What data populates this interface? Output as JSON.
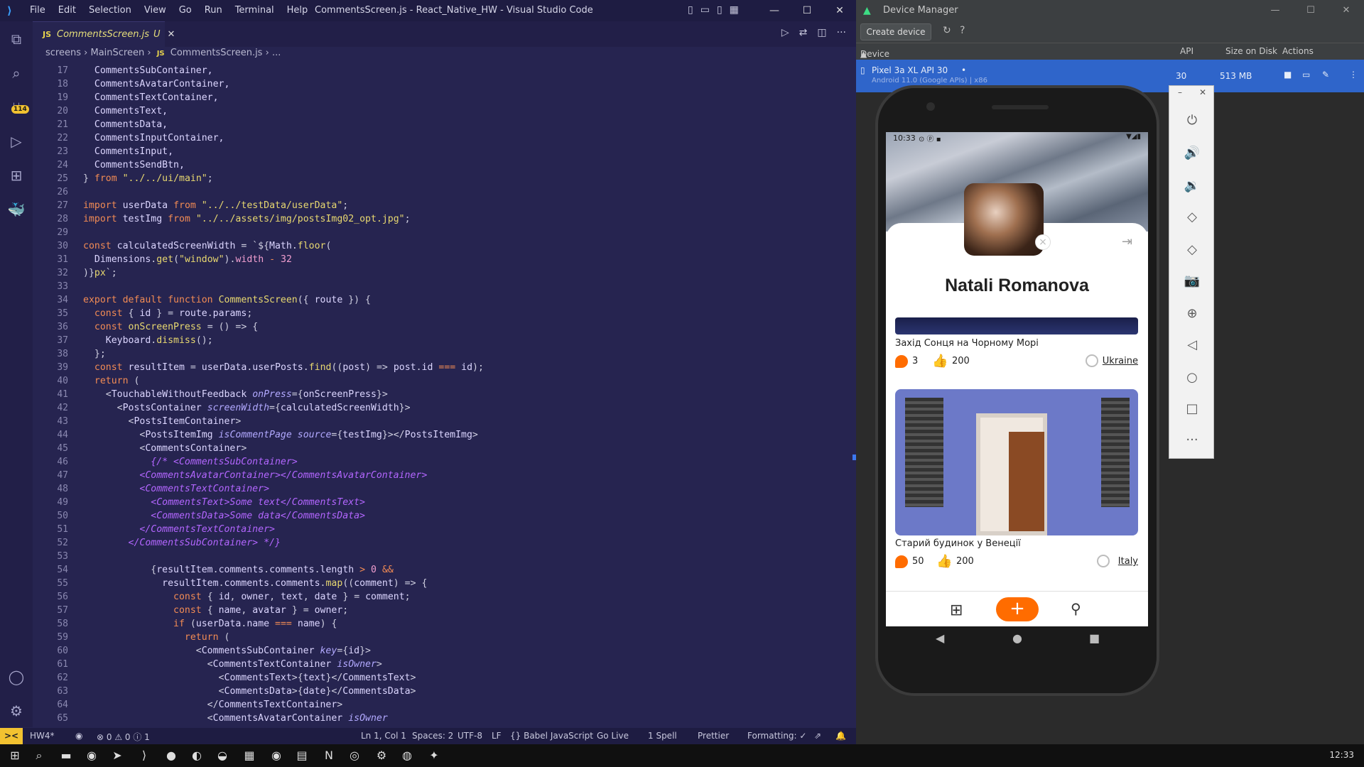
{
  "vscode": {
    "menu": [
      "File",
      "Edit",
      "Selection",
      "View",
      "Go",
      "Run",
      "Terminal",
      "Help"
    ],
    "window_title": "CommentsScreen.js - React_Native_HW - Visual Studio Code",
    "tab": {
      "label": "CommentsScreen.js",
      "status": "U"
    },
    "breadcrumb": [
      "screens",
      "MainScreen",
      "CommentsScreen.js",
      "..."
    ],
    "line_numbers": [
      "17",
      "18",
      "19",
      "20",
      "21",
      "22",
      "23",
      "24",
      "25",
      "26",
      "27",
      "28",
      "29",
      "30",
      "31",
      "32",
      "33",
      "34",
      "35",
      "36",
      "37",
      "38",
      "39",
      "40",
      "41",
      "42",
      "43",
      "44",
      "45",
      "46",
      "47",
      "48",
      "49",
      "50",
      "51",
      "52",
      "53",
      "54",
      "55",
      "56",
      "57",
      "58",
      "59",
      "60",
      "61",
      "62",
      "63",
      "64",
      "65"
    ],
    "source_badge": "114",
    "status": {
      "remote": "><",
      "branch": "HW4*",
      "problems": "⊗ 0 ⚠ 0 ⓘ 1",
      "cursor": "Ln 1, Col 1",
      "spaces": "Spaces: 2",
      "encoding": "UTF-8",
      "eol": "LF",
      "language": "{} Babel JavaScript",
      "golive": "Go Live",
      "spell": "1 Spell",
      "prettier": "Prettier",
      "formatting": "Formatting: ✓"
    }
  },
  "device_manager": {
    "title": "Device Manager",
    "create_button": "Create device",
    "columns": {
      "device": "Device",
      "api": "API",
      "size": "Size on Disk",
      "actions": "Actions"
    },
    "device": {
      "name": "Pixel 3a XL API 30",
      "subtitle": "Android 11.0 (Google APIs) | x86",
      "api": "30",
      "size": "513 MB"
    }
  },
  "phone": {
    "time": "10:33",
    "profile_name": "Natali Romanova",
    "posts": [
      {
        "title": "Захід Сонця на Чорному Морі",
        "comments": "3",
        "likes": "200",
        "location": "Ukraine"
      },
      {
        "title": "Старий будинок у Венеції",
        "comments": "50",
        "likes": "200",
        "location": "Italy"
      }
    ]
  },
  "taskbar": {
    "time": "12:33"
  }
}
